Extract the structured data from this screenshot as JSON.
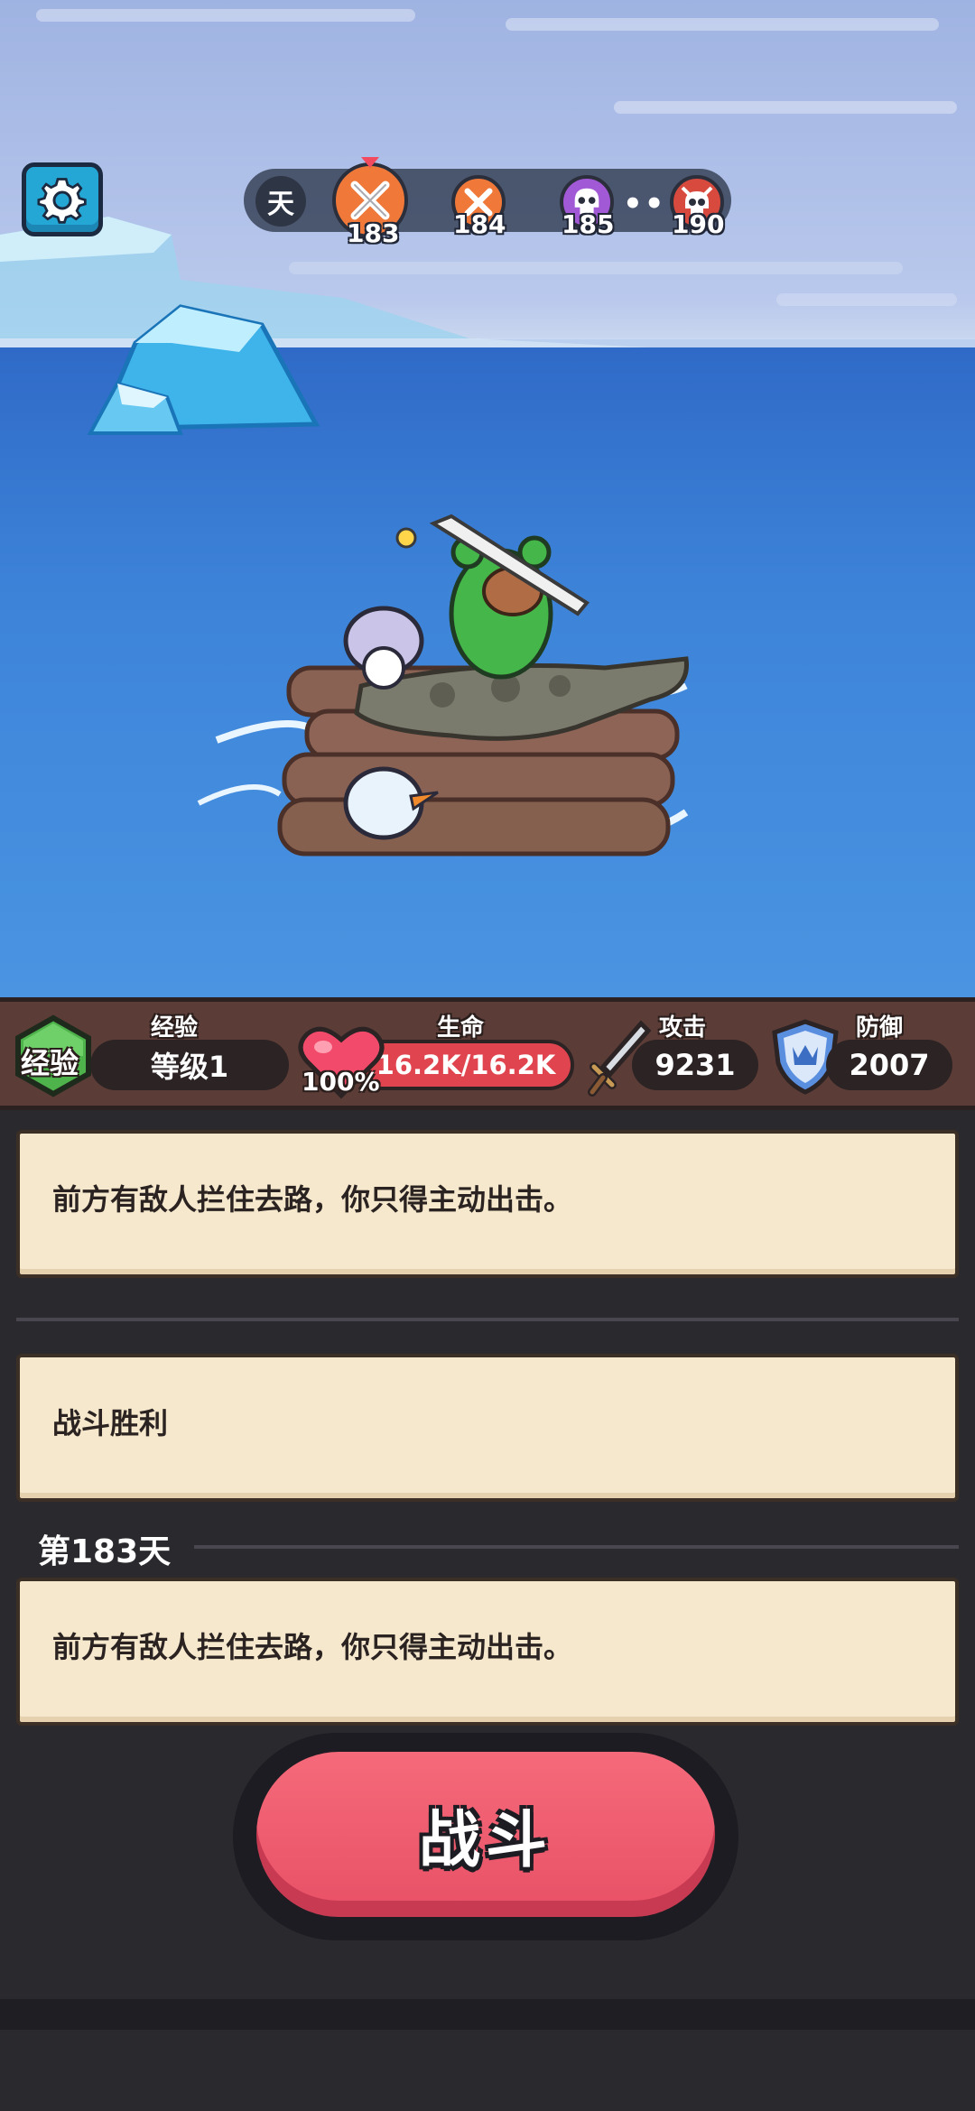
{
  "hud": {
    "day_label": "天",
    "nodes": [
      {
        "day": "183",
        "type": "battle",
        "color": "#f0793a",
        "current": true
      },
      {
        "day": "184",
        "type": "battle",
        "color": "#f0793a"
      },
      {
        "day": "185",
        "type": "skull",
        "color": "#a259d6"
      },
      {
        "day": "190",
        "type": "boss",
        "color": "#d94a3e"
      }
    ],
    "more": "•••"
  },
  "stats": {
    "exp": {
      "badge": "经验",
      "title": "经验",
      "value": "等级1"
    },
    "hp": {
      "title": "生命",
      "percent": "100%",
      "value": "16.2K/16.2K",
      "fill": 1.0
    },
    "attack": {
      "title": "攻击",
      "value": "9231"
    },
    "defense": {
      "title": "防御",
      "value": "2007"
    }
  },
  "log": {
    "entry1": "前方有敌人拦住去路，你只得主动出击。",
    "entry2": "战斗胜利",
    "day_heading": "第183天",
    "entry3": "前方有敌人拦住去路，你只得主动出击。"
  },
  "fight_button": "战斗",
  "colors": {
    "hp_bar": "#e0454f",
    "exp_badge": "#4db34a",
    "fight": "#f05d70"
  }
}
